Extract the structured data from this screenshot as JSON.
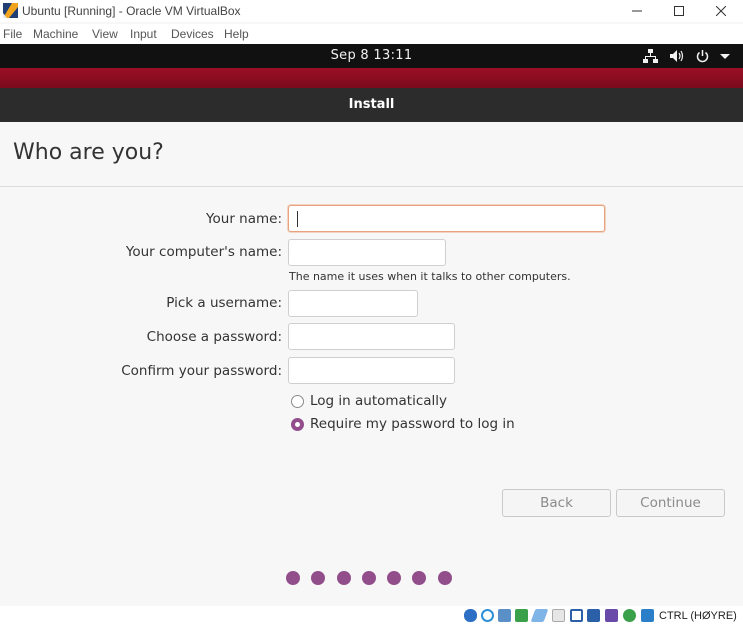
{
  "window": {
    "title": "Ubuntu [Running] - Oracle VM VirtualBox",
    "app_icon": "virtualbox-icon",
    "controls": [
      "minimize-icon",
      "maximize-icon",
      "close-icon"
    ]
  },
  "menubar": {
    "items": [
      "File",
      "Machine",
      "View",
      "Input",
      "Devices",
      "Help"
    ]
  },
  "top_panel": {
    "clock": "Sep 8  13:11",
    "tray_icons": [
      "network-wired-icon",
      "volume-icon",
      "power-icon",
      "chevron-down-icon"
    ]
  },
  "installer": {
    "header_title": "Install",
    "page_title": "Who are you?",
    "fields": {
      "your_name": {
        "label": "Your name:",
        "value": ""
      },
      "computer_name": {
        "label": "Your computer's name:",
        "value": "",
        "hint": "The name it uses when it talks to other computers."
      },
      "username": {
        "label": "Pick a username:",
        "value": ""
      },
      "password": {
        "label": "Choose a password:",
        "value": ""
      },
      "confirm_password": {
        "label": "Confirm your password:",
        "value": ""
      }
    },
    "login_options": [
      {
        "label": "Log in automatically",
        "selected": false
      },
      {
        "label": "Require my password to log in",
        "selected": true
      }
    ],
    "buttons": {
      "back": "Back",
      "continue": "Continue"
    },
    "progress_dots": 7,
    "accent_color": "#924d8b"
  },
  "statusbar": {
    "icons": [
      "hard-disk-icon",
      "optical-disk-icon",
      "audio-icon",
      "network-icon",
      "usb-icon",
      "shared-folder-icon",
      "display-icon",
      "recording-icon",
      "cpu-icon",
      "mouse-integration-icon",
      "keyboard-icon"
    ],
    "host_key": "CTRL (HØYRE)"
  }
}
